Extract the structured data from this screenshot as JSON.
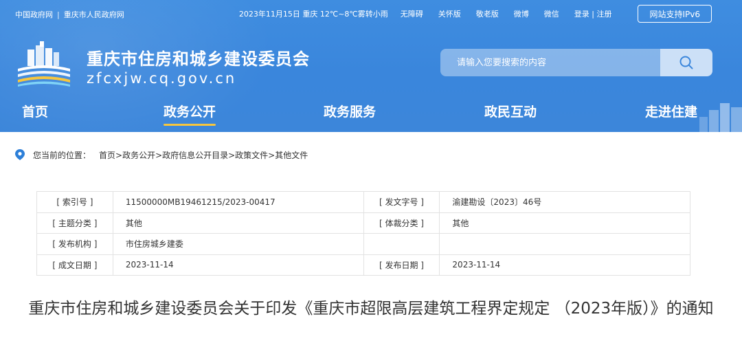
{
  "topbar": {
    "link_gov": "中国政府网",
    "link_cq": "重庆市人民政府网",
    "weather": "2023年11月15日  重庆  12℃~8℃雾转小雨",
    "tools": [
      "无障碍",
      "关怀版",
      "敬老版",
      "微博",
      "微信"
    ],
    "login": "登录 | 注册",
    "ipv6": "网站支持IPv6"
  },
  "site": {
    "title": "重庆市住房和城乡建设委员会",
    "domain": "zfcxjw.cq.gov.cn"
  },
  "search": {
    "placeholder": "请输入您要搜索的内容",
    "icon": "search-icon"
  },
  "nav": {
    "items": [
      "首页",
      "政务公开",
      "政务服务",
      "政民互动",
      "走进住建"
    ],
    "active": "政务公开"
  },
  "breadcrumb": {
    "label": "您当前的位置：",
    "path": "首页>政务公开>政府信息公开目录>政策文件>其他文件"
  },
  "meta": {
    "rows": [
      {
        "k1": "[ 索引号 ]",
        "v1": "11500000MB19461215/2023-00417",
        "k2": "[ 发文字号 ]",
        "v2": "渝建勘设〔2023〕46号"
      },
      {
        "k1": "[ 主题分类 ]",
        "v1": "其他",
        "k2": "[ 体裁分类 ]",
        "v2": "其他"
      },
      {
        "k1": "[ 发布机构 ]",
        "v1": "市住房城乡建委",
        "k2": "",
        "v2": ""
      },
      {
        "k1": "[ 成文日期 ]",
        "v1": "2023-11-14",
        "k2": "[ 发布日期 ]",
        "v2": "2023-11-14"
      }
    ]
  },
  "article": {
    "title": "重庆市住房和城乡建设委员会关于印发《重庆市超限高层建筑工程界定规定 （2023年版）》的通知"
  },
  "colors": {
    "header_blue": "#3a86dc",
    "nav_active_underline": "#f7c63d"
  }
}
